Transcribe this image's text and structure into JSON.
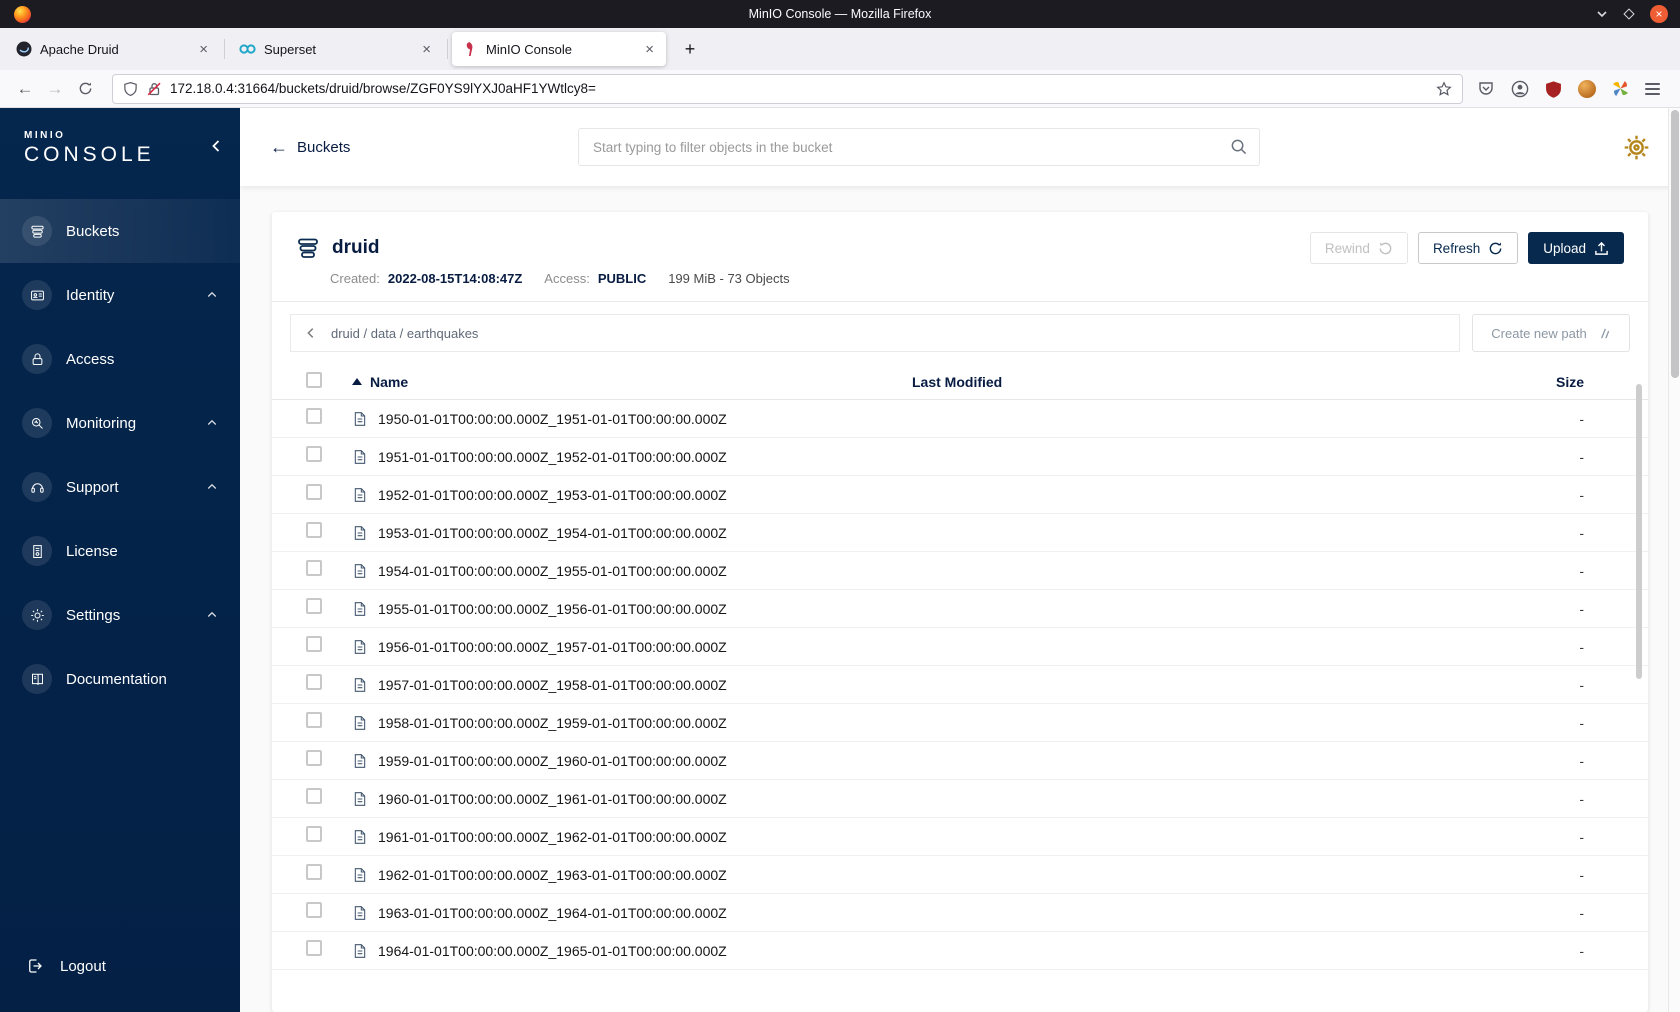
{
  "browser_chrome": {
    "window_title": "MinIO Console — Mozilla Firefox",
    "tabs": [
      {
        "label": "Apache Druid"
      },
      {
        "label": "Superset"
      },
      {
        "label": "MinIO Console"
      }
    ],
    "url": "172.18.0.4:31664/buckets/druid/browse/ZGF0YS9lYXJ0aHF1YWtlcy8="
  },
  "sidebar": {
    "logo_line1": "MINIO",
    "logo_line2": "CONSOLE",
    "items": [
      {
        "label": "Buckets",
        "icon": "buckets-icon",
        "active": true
      },
      {
        "label": "Identity",
        "icon": "identity-icon",
        "expandable": true
      },
      {
        "label": "Access",
        "icon": "access-icon"
      },
      {
        "label": "Monitoring",
        "icon": "monitoring-icon",
        "expandable": true
      },
      {
        "label": "Support",
        "icon": "support-icon",
        "expandable": true
      },
      {
        "label": "License",
        "icon": "license-icon"
      },
      {
        "label": "Settings",
        "icon": "settings-icon",
        "expandable": true
      },
      {
        "label": "Documentation",
        "icon": "documentation-icon"
      }
    ],
    "logout_label": "Logout"
  },
  "header": {
    "back_label": "Buckets",
    "search_placeholder": "Start typing to filter objects in the bucket"
  },
  "bucket": {
    "name": "druid",
    "created_label": "Created:",
    "created_value": "2022-08-15T14:08:47Z",
    "access_label": "Access:",
    "access_value": "PUBLIC",
    "stats": "199 MiB - 73 Objects",
    "buttons": {
      "rewind": "Rewind",
      "refresh": "Refresh",
      "upload": "Upload"
    }
  },
  "objects": {
    "breadcrumb": [
      "druid",
      "data",
      "earthquakes"
    ],
    "create_path_label": "Create new path",
    "columns": {
      "name": "Name",
      "last_modified": "Last Modified",
      "size": "Size"
    },
    "rows": [
      {
        "name": "1950-01-01T00:00:00.000Z_1951-01-01T00:00:00.000Z",
        "last_modified": "",
        "size": "-"
      },
      {
        "name": "1951-01-01T00:00:00.000Z_1952-01-01T00:00:00.000Z",
        "last_modified": "",
        "size": "-"
      },
      {
        "name": "1952-01-01T00:00:00.000Z_1953-01-01T00:00:00.000Z",
        "last_modified": "",
        "size": "-"
      },
      {
        "name": "1953-01-01T00:00:00.000Z_1954-01-01T00:00:00.000Z",
        "last_modified": "",
        "size": "-"
      },
      {
        "name": "1954-01-01T00:00:00.000Z_1955-01-01T00:00:00.000Z",
        "last_modified": "",
        "size": "-"
      },
      {
        "name": "1955-01-01T00:00:00.000Z_1956-01-01T00:00:00.000Z",
        "last_modified": "",
        "size": "-"
      },
      {
        "name": "1956-01-01T00:00:00.000Z_1957-01-01T00:00:00.000Z",
        "last_modified": "",
        "size": "-"
      },
      {
        "name": "1957-01-01T00:00:00.000Z_1958-01-01T00:00:00.000Z",
        "last_modified": "",
        "size": "-"
      },
      {
        "name": "1958-01-01T00:00:00.000Z_1959-01-01T00:00:00.000Z",
        "last_modified": "",
        "size": "-"
      },
      {
        "name": "1959-01-01T00:00:00.000Z_1960-01-01T00:00:00.000Z",
        "last_modified": "",
        "size": "-"
      },
      {
        "name": "1960-01-01T00:00:00.000Z_1961-01-01T00:00:00.000Z",
        "last_modified": "",
        "size": "-"
      },
      {
        "name": "1961-01-01T00:00:00.000Z_1962-01-01T00:00:00.000Z",
        "last_modified": "",
        "size": "-"
      },
      {
        "name": "1962-01-01T00:00:00.000Z_1963-01-01T00:00:00.000Z",
        "last_modified": "",
        "size": "-"
      },
      {
        "name": "1963-01-01T00:00:00.000Z_1964-01-01T00:00:00.000Z",
        "last_modified": "",
        "size": "-"
      },
      {
        "name": "1964-01-01T00:00:00.000Z_1965-01-01T00:00:00.000Z",
        "last_modified": "",
        "size": "-"
      }
    ]
  },
  "colors": {
    "sidebar_navy": "#05264d",
    "accent_navy": "#081c42",
    "upload_button": "#07294e",
    "gear_gold": "#b5861b",
    "minio_red": "#c9304a"
  }
}
